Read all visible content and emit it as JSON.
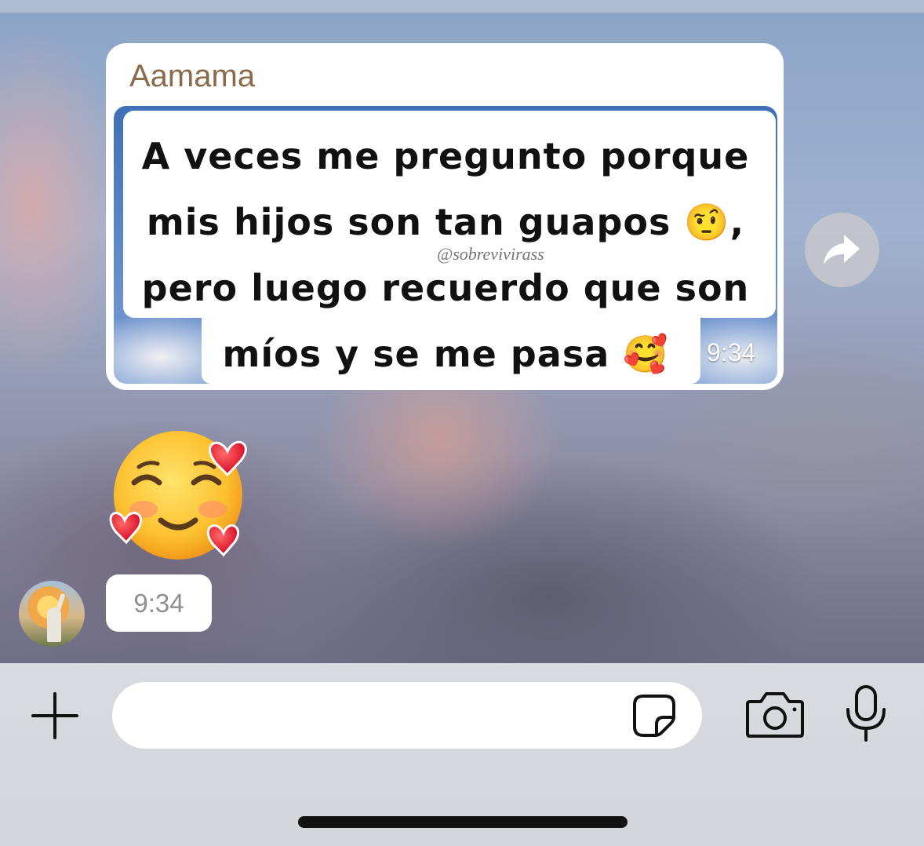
{
  "chat": {
    "message_photo": {
      "sender": "Aamama",
      "caption_lines": [
        "A veces me pregunto porque",
        "mis hijos son tan guapos 🤨,",
        "pero luego recuerdo que son",
        "míos y se me pasa 🥰"
      ],
      "watermark": "@sobrevivirass",
      "time": "9:34"
    },
    "message_emoji": {
      "emoji": "🥰",
      "time": "9:34"
    }
  },
  "icons": {
    "forward": "forward-icon",
    "plus": "plus-icon",
    "sticker": "sticker-icon",
    "camera": "camera-icon",
    "mic": "microphone-icon"
  },
  "colors": {
    "sender_name": "#8a6a4a",
    "bubble": "#ffffff",
    "input_bar": "#d9dbe1"
  }
}
